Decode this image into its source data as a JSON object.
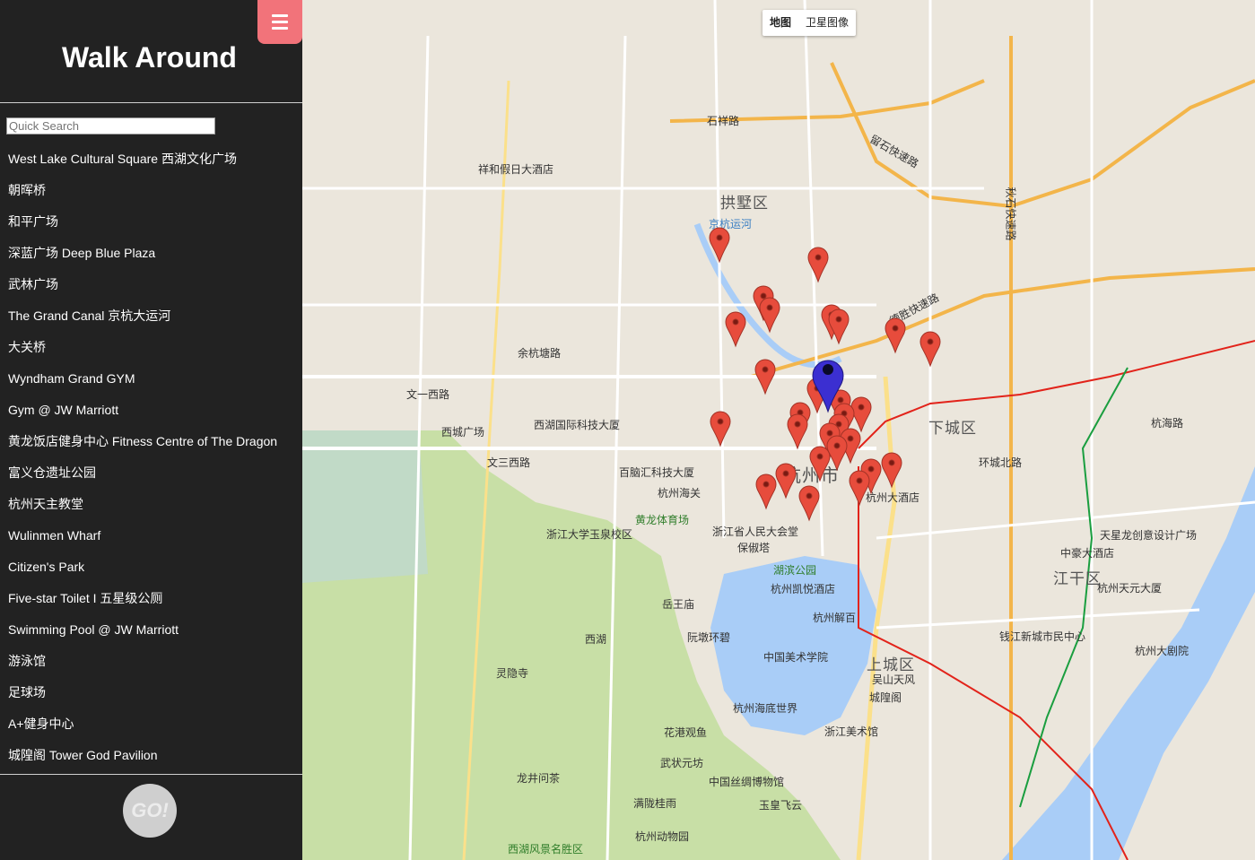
{
  "app": {
    "title": "Walk Around"
  },
  "search": {
    "placeholder": "Quick Search"
  },
  "places": [
    "West Lake Cultural Square 西湖文化广场",
    "朝晖桥",
    "和平广场",
    "深蓝广场 Deep Blue Plaza",
    "武林广场",
    "The Grand Canal 京杭大运河",
    "大关桥",
    "Wyndham Grand GYM",
    "Gym @ JW Marriott",
    "黄龙饭店健身中心 Fitness Centre of The Dragon",
    "富义仓遗址公园",
    "杭州天主教堂",
    "Wulinmen Wharf",
    "Citizen's Park",
    "Five-star Toilet I 五星级公厕",
    "Swimming Pool @ JW Marriott",
    "游泳馆",
    "足球场",
    "A+健身中心",
    "城隍阁 Tower God Pavilion"
  ],
  "go_button": "GO!",
  "map_type": {
    "map": "地图",
    "satellite": "卫星图像"
  },
  "colors": {
    "sidebar": "#222222",
    "menu": "#f2737a",
    "water": "#a9cdf7",
    "park": "#c8dfa6",
    "marker": "#e74c3c",
    "current_marker": "#3b2fd1"
  },
  "map_labels": {
    "districts": [
      "拱墅区",
      "下城区",
      "杭州市",
      "上城区",
      "江干区"
    ],
    "roads": [
      "石祥路",
      "留石快速路",
      "德胜快速路",
      "秋石快速路",
      "余杭塘路",
      "文一西路",
      "文三西路",
      "环城北路",
      "杭海路"
    ],
    "pois": [
      "祥和假日大酒店",
      "西湖国际科技大厦",
      "西城广场",
      "百脑汇科技大厦",
      "杭州海关",
      "黄龙体育场",
      "浙江大学玉泉校区",
      "浙江省人民大会堂",
      "保俶塔",
      "湖滨公园",
      "杭州凯悦酒店",
      "杭州解百",
      "岳王庙",
      "阮墩环碧",
      "中国美术学院",
      "灵隐寺",
      "吴山天风",
      "城隍阁",
      "杭州海底世界",
      "花港观鱼",
      "浙江美术馆",
      "武状元坊",
      "中国丝绸博物馆",
      "龙井问茶",
      "满陇桂雨",
      "玉皇飞云",
      "杭州动物园",
      "西湖风景名胜区",
      "天星龙创意设计广场",
      "中豪大酒店",
      "杭州天元大厦",
      "钱江新城市民中心",
      "杭州大剧院",
      "杭州大酒店",
      "京杭运河",
      "西湖"
    ]
  }
}
